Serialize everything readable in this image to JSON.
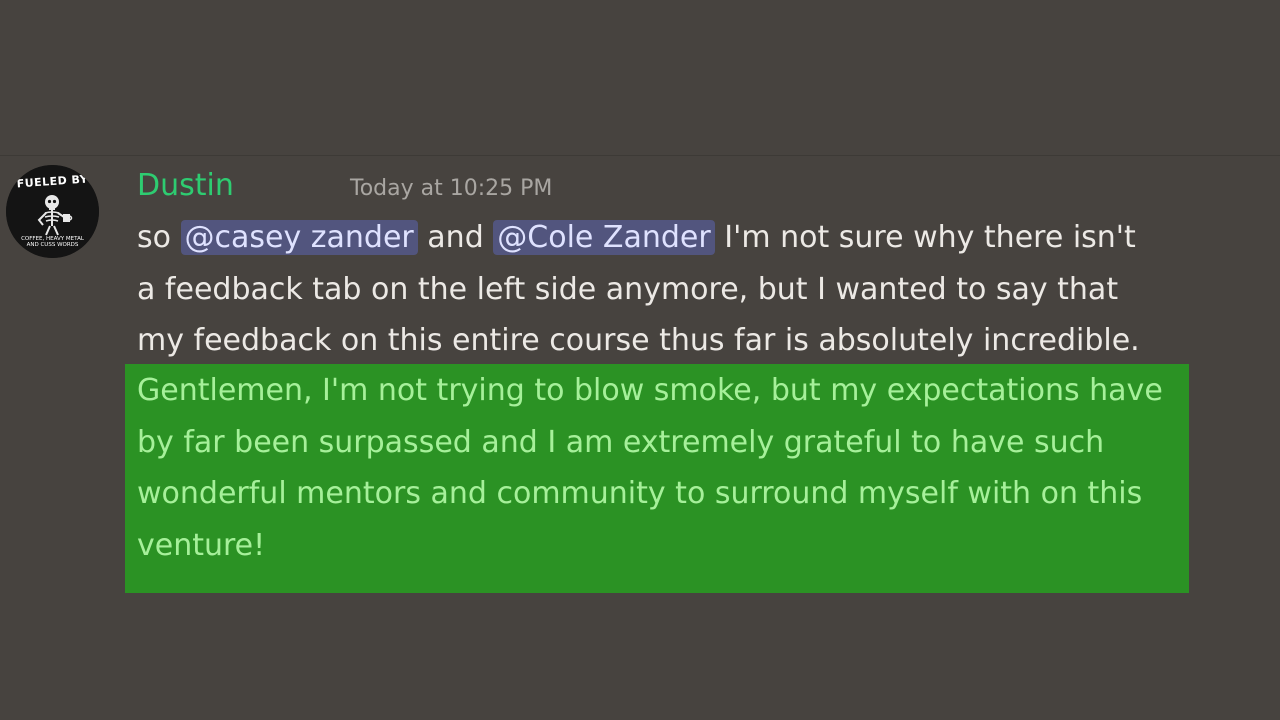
{
  "message": {
    "author": {
      "name": "Dustin",
      "avatar_text_top": "FUELED BY",
      "avatar_text_bottom": "COFFEE, HEAVY METAL AND CUSS WORDS",
      "name_color": "#2ecc71"
    },
    "timestamp": "Today at 10:25 PM",
    "line1": {
      "pre": "so ",
      "mention1": "@casey zander",
      "mid": " and ",
      "mention2": "@Cole Zander",
      "post": " I'm not sure why there isn't"
    },
    "line2": "a feedback tab on the left side anymore, but I wanted to say that",
    "line3": "my feedback on this entire course thus far is absolutely incredible.",
    "highlighted_lines": [
      "Gentlemen, I'm not trying to blow smoke, but my expectations have",
      "by far been surpassed and I am extremely grateful to have such",
      "wonderful mentors and community to surround myself with on this",
      "venture!"
    ],
    "colors": {
      "background": "#47433f",
      "mention_bg": "#52557e",
      "highlight_bg": "#2b9224",
      "highlight_text": "#a6f09a"
    }
  }
}
